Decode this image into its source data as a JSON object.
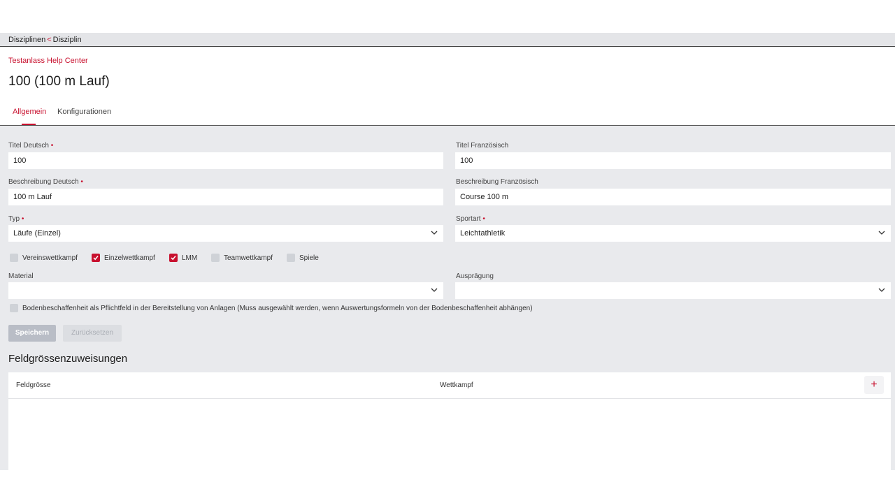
{
  "breadcrumb": {
    "parent": "Disziplinen",
    "separator": "<",
    "current": "Disziplin"
  },
  "header": {
    "org_link": "Testanlass Help Center",
    "title": "100 (100 m Lauf)"
  },
  "tabs": [
    {
      "label": "Allgemein",
      "active": true
    },
    {
      "label": "Konfigurationen",
      "active": false
    }
  ],
  "form": {
    "required_marker": "•",
    "titel_de": {
      "label": "Titel Deutsch",
      "value": "100",
      "required": true
    },
    "titel_fr": {
      "label": "Titel Französisch",
      "value": "100",
      "required": false
    },
    "beschreibung_de": {
      "label": "Beschreibung Deutsch",
      "value": "100 m Lauf",
      "required": true
    },
    "beschreibung_fr": {
      "label": "Beschreibung Französisch",
      "value": "Course 100 m",
      "required": false
    },
    "typ": {
      "label": "Typ",
      "value": "Läufe (Einzel)",
      "required": true
    },
    "sportart": {
      "label": "Sportart",
      "value": "Leichtathletik",
      "required": true
    },
    "checkboxes": [
      {
        "label": "Vereinswettkampf",
        "checked": false
      },
      {
        "label": "Einzelwettkampf",
        "checked": true
      },
      {
        "label": "LMM",
        "checked": true
      },
      {
        "label": "Teamwettkampf",
        "checked": false
      },
      {
        "label": "Spiele",
        "checked": false
      }
    ],
    "material": {
      "label": "Material",
      "value": ""
    },
    "auspraegung": {
      "label": "Ausprägung",
      "value": ""
    },
    "boden_checkbox": {
      "label": "Bodenbeschaffenheit als Pflichtfeld in der Bereitstellung von Anlagen (Muss ausgewählt werden, wenn Auswertungsformeln von der Bodenbeschaffenheit abhängen)",
      "checked": false
    },
    "save_label": "Speichern",
    "reset_label": "Zurücksetzen"
  },
  "feldgroessen": {
    "title": "Feldgrössenzuweisungen",
    "columns": [
      "Feldgrösse",
      "Wettkampf"
    ],
    "add_label": "+",
    "rows": []
  },
  "colors": {
    "accent": "#c8102e",
    "background": "#e9eaed"
  }
}
